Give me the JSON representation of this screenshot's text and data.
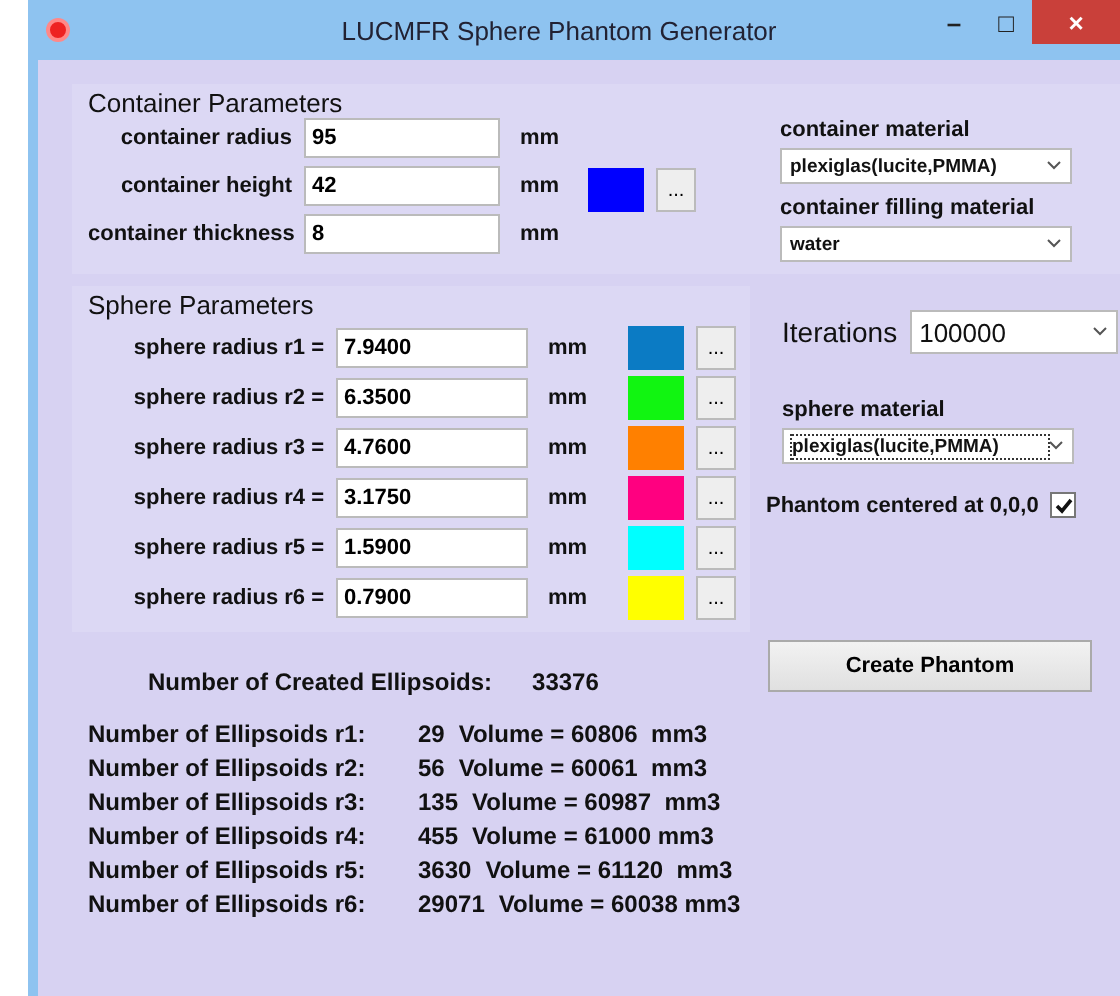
{
  "window": {
    "title": "LUCMFR Sphere Phantom Generator",
    "controls": [
      "–",
      "□",
      "×"
    ]
  },
  "container": {
    "title": "Container Parameters",
    "fields": [
      {
        "label": "container radius",
        "value": "95",
        "unit": "mm"
      },
      {
        "label": "container height",
        "value": "42",
        "unit": "mm"
      },
      {
        "label": "container thickness",
        "value": "8",
        "unit": "mm"
      }
    ],
    "color": "#0000ff",
    "color_button": "...",
    "material_label": "container material",
    "material": "plexiglas(lucite,PMMA)",
    "filling_label": "container filling material",
    "filling": "water"
  },
  "spheres": {
    "title": "Sphere Parameters",
    "rows": [
      {
        "label": "sphere radius r1 =",
        "value": "7.9400",
        "unit": "mm",
        "color": "#0b7bc4",
        "button": "..."
      },
      {
        "label": "sphere radius r2 =",
        "value": "6.3500",
        "unit": "mm",
        "color": "#11f511",
        "button": "..."
      },
      {
        "label": "sphere radius r3 =",
        "value": "4.7600",
        "unit": "mm",
        "color": "#ff8000",
        "button": "..."
      },
      {
        "label": "sphere radius r4 =",
        "value": "3.1750",
        "unit": "mm",
        "color": "#ff0080",
        "button": "..."
      },
      {
        "label": "sphere radius r5 =",
        "value": "1.5900",
        "unit": "mm",
        "color": "#00ffff",
        "button": "..."
      },
      {
        "label": "sphere radius r6 =",
        "value": "0.7900",
        "unit": "mm",
        "color": "#ffff00",
        "button": "..."
      }
    ]
  },
  "iterations": {
    "label": "Iterations",
    "value": "100000"
  },
  "sphere_material": {
    "label": "sphere material",
    "value": "plexiglas(lucite,PMMA)",
    "focused": true
  },
  "centered": {
    "label": "Phantom centered at 0,0,0",
    "checked": true
  },
  "create_button": "Create Phantom",
  "created": {
    "label": "Number of Created Ellipsoids:",
    "value": "33376"
  },
  "results": [
    {
      "label": "Number of Ellipsoids r1:",
      "count": "29",
      "volume": "Volume = 60806  mm3"
    },
    {
      "label": "Number of Ellipsoids r2:",
      "count": "56",
      "volume": "Volume = 60061  mm3"
    },
    {
      "label": "Number of Ellipsoids r3:",
      "count": "135",
      "volume": "Volume = 60987  mm3"
    },
    {
      "label": "Number of Ellipsoids r4:",
      "count": "455",
      "volume": "Volume = 61000 mm3"
    },
    {
      "label": "Number of Ellipsoids r5:",
      "count": "3630",
      "volume": "Volume = 61120  mm3"
    },
    {
      "label": "Number of Ellipsoids r6:",
      "count": "29071",
      "volume": "Volume = 60038 mm3"
    }
  ]
}
